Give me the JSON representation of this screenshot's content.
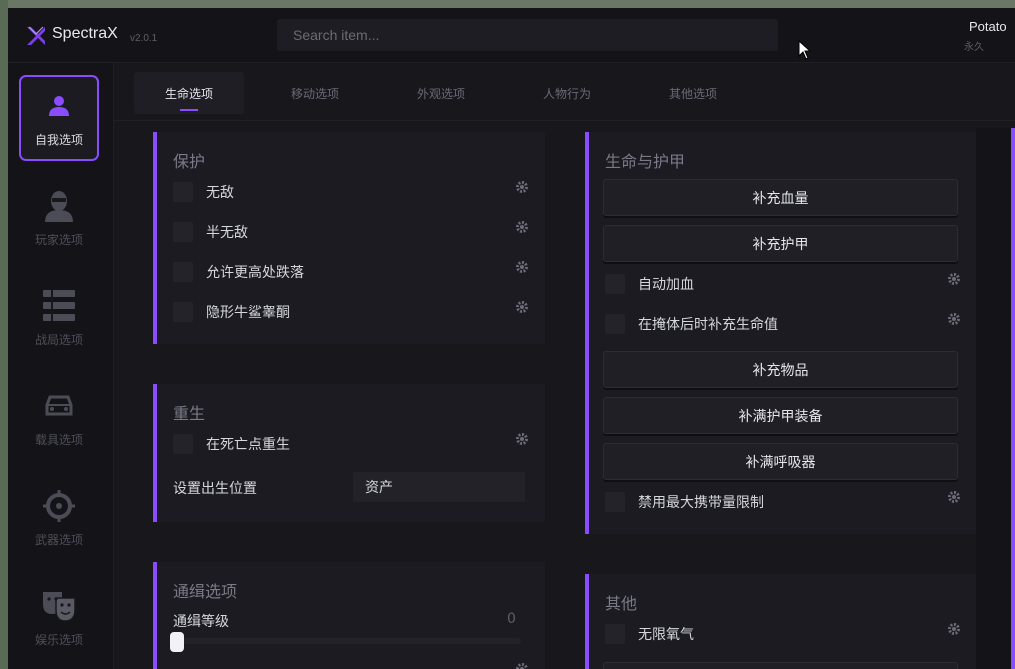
{
  "app": {
    "brand": "SpectraX",
    "version": "v2.0.1",
    "search_placeholder": "Search item...",
    "user": {
      "name": "Potato",
      "subtitle": "永久"
    }
  },
  "sidebar": {
    "items": [
      {
        "label": "自我选项",
        "icon": "person-icon",
        "active": true
      },
      {
        "label": "玩家选项",
        "icon": "masked-player-icon",
        "active": false
      },
      {
        "label": "战局选项",
        "icon": "session-list-icon",
        "active": false
      },
      {
        "label": "载具选项",
        "icon": "car-icon",
        "active": false
      },
      {
        "label": "武器选项",
        "icon": "crosshair-icon",
        "active": false
      },
      {
        "label": "娱乐选项",
        "icon": "theater-masks-icon",
        "active": false
      }
    ]
  },
  "tabs": [
    {
      "label": "生命选项",
      "active": true
    },
    {
      "label": "移动选项",
      "active": false
    },
    {
      "label": "外观选项",
      "active": false
    },
    {
      "label": "人物行为",
      "active": false
    },
    {
      "label": "其他选项",
      "active": false
    }
  ],
  "protection": {
    "title": "保护",
    "options": [
      "无敌",
      "半无敌",
      "允许更高处跌落",
      "隐形牛鲨睾酮"
    ]
  },
  "respawn": {
    "title": "重生",
    "option": "在死亡点重生",
    "spawn_label": "设置出生位置",
    "spawn_value": "资产"
  },
  "wanted": {
    "title": "通缉选项",
    "level_label": "通缉等级",
    "level_value": "0",
    "level_fraction": 0
  },
  "health_armor": {
    "title": "生命与护甲",
    "btn_refill_health": "补充血量",
    "btn_refill_armor": "补充护甲",
    "opt_auto_heal": "自动加血",
    "opt_cover_heal": "在掩体后时补充生命值",
    "btn_refill_items": "补充物品",
    "btn_full_armor_gear": "补满护甲装备",
    "btn_full_rebreather": "补满呼吸器",
    "opt_disable_carry_limit": "禁用最大携带量限制"
  },
  "other": {
    "title": "其他",
    "opt_infinite_oxygen": "无限氧气"
  },
  "colors": {
    "accent": "#8a4cff",
    "panel": "#1b1b21",
    "background": "#17171c"
  }
}
